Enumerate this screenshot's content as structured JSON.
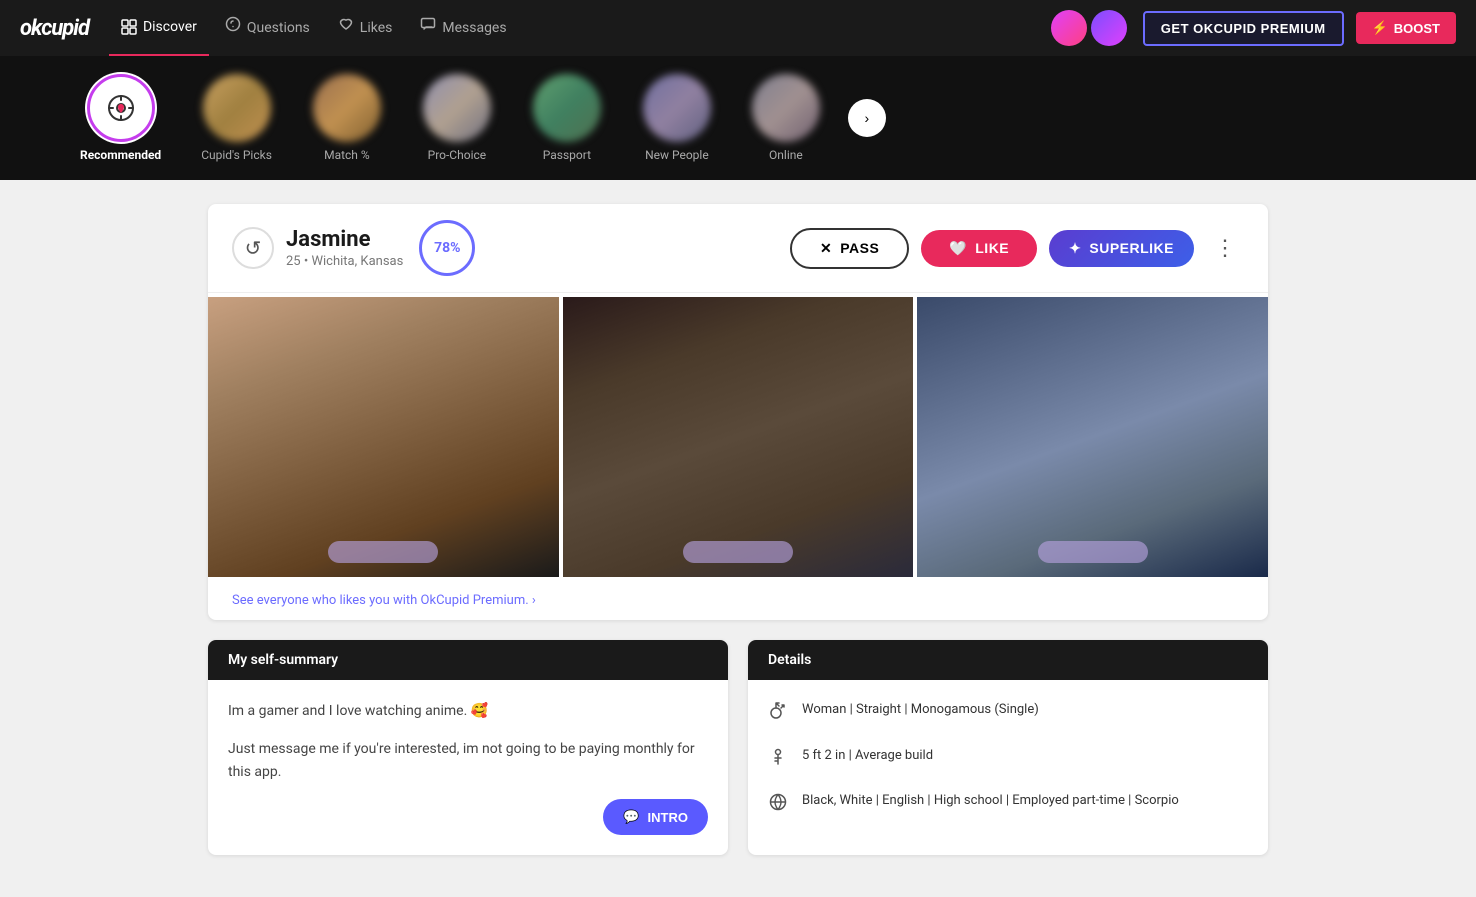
{
  "app": {
    "logo": "okcupid",
    "nav_items": [
      {
        "id": "discover",
        "label": "Discover",
        "icon": "🔲",
        "active": true
      },
      {
        "id": "questions",
        "label": "Questions",
        "icon": "❓"
      },
      {
        "id": "likes",
        "label": "Likes",
        "icon": "♡"
      },
      {
        "id": "messages",
        "label": "Messages",
        "icon": "💬"
      }
    ],
    "btn_premium": "GET OKCUPID PREMIUM",
    "btn_boost": "BOOST"
  },
  "categories": [
    {
      "id": "recommended",
      "label": "Recommended",
      "active": true,
      "type": "icon"
    },
    {
      "id": "cupids-picks",
      "label": "Cupid's Picks",
      "active": false,
      "type": "thumb",
      "style": "cupid"
    },
    {
      "id": "match",
      "label": "Match %",
      "active": false,
      "type": "thumb",
      "style": "match"
    },
    {
      "id": "pro-choice",
      "label": "Pro-Choice",
      "active": false,
      "type": "thumb",
      "style": "pro"
    },
    {
      "id": "passport",
      "label": "Passport",
      "active": false,
      "type": "thumb",
      "style": "passport"
    },
    {
      "id": "new-people",
      "label": "New People",
      "active": false,
      "type": "thumb",
      "style": "newpeople"
    },
    {
      "id": "online",
      "label": "Online",
      "active": false,
      "type": "thumb",
      "style": "online"
    }
  ],
  "profile": {
    "name": "Jasmine",
    "age": "25",
    "location": "Wichita, Kansas",
    "match_percent": "78%",
    "actions": {
      "pass": "PASS",
      "like": "LIKE",
      "superlike": "SUPERLIKE"
    },
    "premium_cta": "See everyone who likes you with OkCupid Premium. ›",
    "self_summary": {
      "section_title": "My self-summary",
      "paragraph1": "Im a gamer and I love watching anime. 🥰",
      "paragraph2": "Just message me if you're interested, im not going to be paying monthly for this app.",
      "intro_btn": "INTRO"
    },
    "details": {
      "section_title": "Details",
      "items": [
        {
          "icon": "gender",
          "text": "Woman | Straight | Monogamous (Single)"
        },
        {
          "icon": "height",
          "text": "5 ft 2 in | Average build"
        },
        {
          "icon": "globe",
          "text": "Black, White | English | High school | Employed part-time | Scorpio"
        }
      ]
    }
  }
}
